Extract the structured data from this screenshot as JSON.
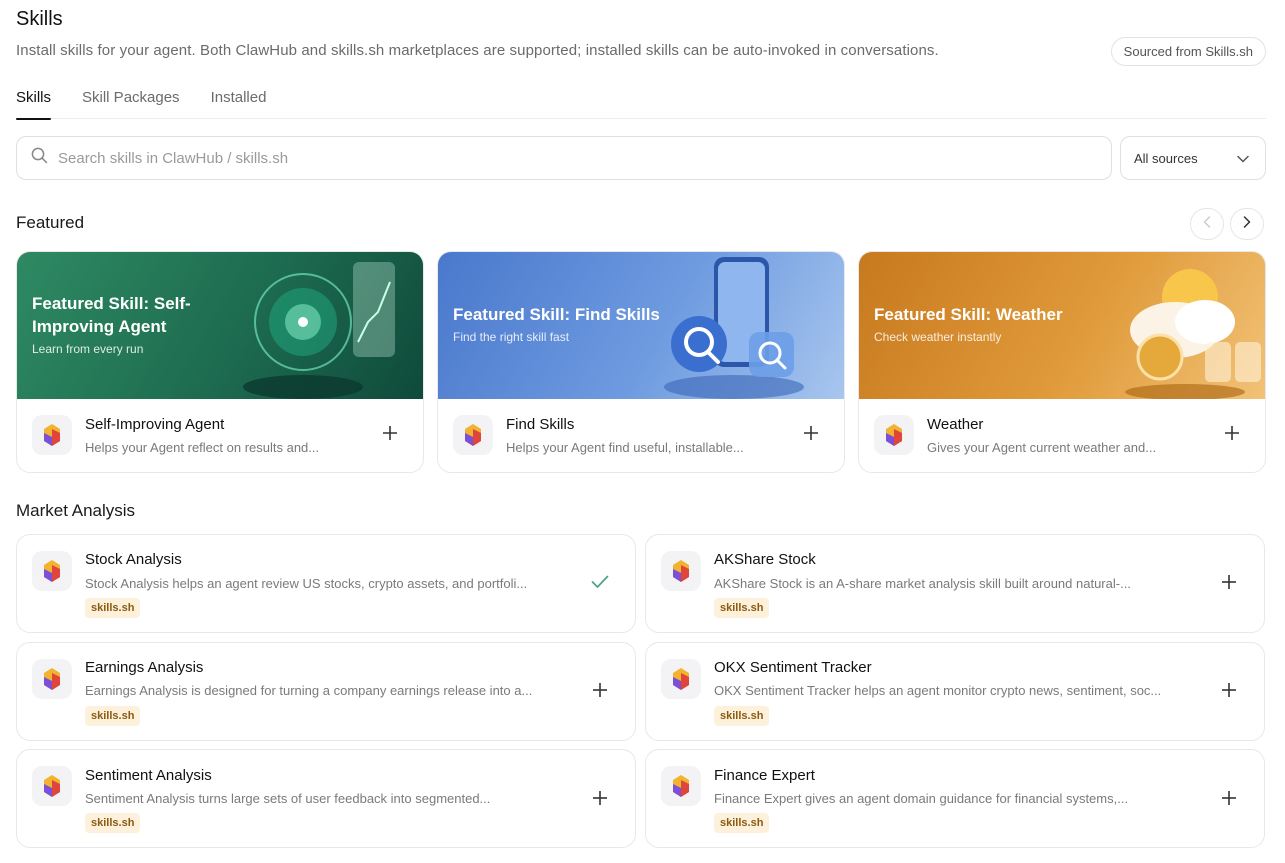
{
  "header": {
    "title": "Skills",
    "subtitle": "Install skills for your agent. Both ClawHub and skills.sh marketplaces are supported; installed skills can be auto-invoked in conversations.",
    "source_pill": "Sourced from Skills.sh"
  },
  "tabs": [
    {
      "label": "Skills",
      "active": true
    },
    {
      "label": "Skill Packages",
      "active": false
    },
    {
      "label": "Installed",
      "active": false
    }
  ],
  "search": {
    "placeholder": "Search skills in ClawHub / skills.sh",
    "value": ""
  },
  "source_filter": {
    "selected": "All sources"
  },
  "featured": {
    "title": "Featured",
    "cards": [
      {
        "banner_title": "Featured Skill: Self-Improving Agent",
        "banner_sub": "Learn from every run",
        "name": "Self-Improving Agent",
        "desc": "Helps your Agent reflect on results and...",
        "theme": "#1f7a5a"
      },
      {
        "banner_title": "Featured Skill: Find Skills",
        "banner_sub": "Find the right skill fast",
        "name": "Find Skills",
        "desc": "Helps your Agent find useful, installable...",
        "theme": "#4a7fd0"
      },
      {
        "banner_title": "Featured Skill: Weather",
        "banner_sub": "Check weather instantly",
        "name": "Weather",
        "desc": "Gives your Agent current weather and...",
        "theme": "#d08a2a"
      }
    ]
  },
  "market": {
    "title": "Market Analysis",
    "items": [
      {
        "name": "Stock Analysis",
        "desc": "Stock Analysis helps an agent review US stocks, crypto assets, and portfoli...",
        "badge": "skills.sh",
        "installed": true
      },
      {
        "name": "AKShare Stock",
        "desc": "AKShare Stock is an A-share market analysis skill built around natural-...",
        "badge": "skills.sh",
        "installed": false
      },
      {
        "name": "Earnings Analysis",
        "desc": "Earnings Analysis is designed for turning a company earnings release into a...",
        "badge": "skills.sh",
        "installed": false
      },
      {
        "name": "OKX Sentiment Tracker",
        "desc": "OKX Sentiment Tracker helps an agent monitor crypto news, sentiment, soc...",
        "badge": "skills.sh",
        "installed": false
      },
      {
        "name": "Sentiment Analysis",
        "desc": "Sentiment Analysis turns large sets of user feedback into segmented...",
        "badge": "skills.sh",
        "installed": false
      },
      {
        "name": "Finance Expert",
        "desc": "Finance Expert gives an agent domain guidance for financial systems,...",
        "badge": "skills.sh",
        "installed": false
      }
    ]
  },
  "colors": {
    "accent": "#111111",
    "badge_bg": "#fdf1dc",
    "badge_text": "#8a5a10",
    "installed_check": "#4aa383"
  }
}
